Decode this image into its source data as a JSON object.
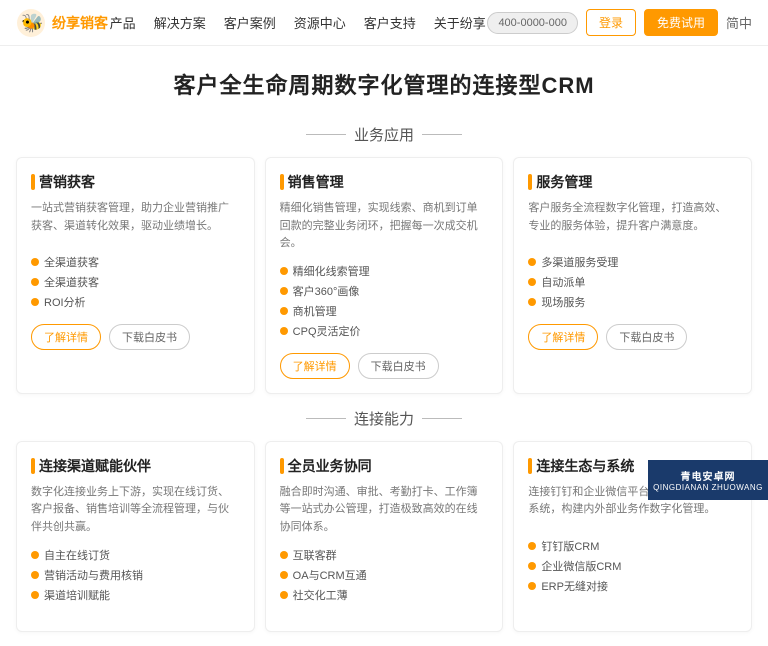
{
  "header": {
    "logo_text": "纷享销客",
    "nav": [
      "产品",
      "解决方案",
      "客户案例",
      "资源中心",
      "客户支持",
      "关于纷享"
    ],
    "phone_btn": "400-0000-000",
    "login_btn": "登录",
    "trial_btn": "免费试用",
    "lang_label": "简中"
  },
  "hero": {
    "title": "客户全生命周期数字化管理的连接型CRM"
  },
  "section_business": {
    "label": "业务应用"
  },
  "section_connect": {
    "label": "连接能力"
  },
  "cards_business": [
    {
      "title": "营销获客",
      "desc": "一站式营销获客管理，助力企业营销推广获客、渠道转化效果，驱动业绩增长。",
      "features": [
        "全渠道获客",
        "全渠道获客",
        "ROI分析"
      ],
      "btn_detail": "了解详情",
      "btn_download": "下载白皮书"
    },
    {
      "title": "销售管理",
      "desc": "精细化销售管理，实现线索、商机到订单回款的完整业务闭环，把握每一次成交机会。",
      "features": [
        "精细化线索管理",
        "客户360°画像",
        "商机管理",
        "CPQ灵活定价"
      ],
      "btn_detail": "了解详情",
      "btn_download": "下载白皮书"
    },
    {
      "title": "服务管理",
      "desc": "客户服务全流程数字化管理，打造高效、专业的服务体验，提升客户满意度。",
      "features": [
        "多渠道服务受理",
        "自动派单",
        "现场服务"
      ],
      "btn_detail": "了解详情",
      "btn_download": "下载白皮书"
    }
  ],
  "cards_connect": [
    {
      "title": "连接渠道赋能伙伴",
      "desc": "数字化连接业务上下游，实现在线订货、客户报备、销售培训等全流程管理，与伙伴共创共赢。",
      "features": [
        "自主在线订货",
        "营销活动与费用核销",
        "渠道培训赋能"
      ],
      "btn_detail": "",
      "btn_download": ""
    },
    {
      "title": "全员业务协同",
      "desc": "融合即时沟通、审批、考勤打卡、工作簿等一站式办公管理，打造极致高效的在线协同体系。",
      "features": [
        "互联客群",
        "OA与CRM互通",
        "社交化工薄"
      ],
      "btn_detail": "",
      "btn_download": ""
    },
    {
      "title": "连接生态与系统",
      "desc": "连接钉钉和企业微信平台，无缝对接ERP系统，构建内外部业务作数字化管理。",
      "features": [
        "钉钉版CRM",
        "企业微信版CRM",
        "ERP无缝对接"
      ],
      "btn_detail": "",
      "btn_download": ""
    }
  ],
  "watermark": {
    "top": "青电安卓网",
    "bottom": "QINGDIANAN ZHUOWANG"
  }
}
